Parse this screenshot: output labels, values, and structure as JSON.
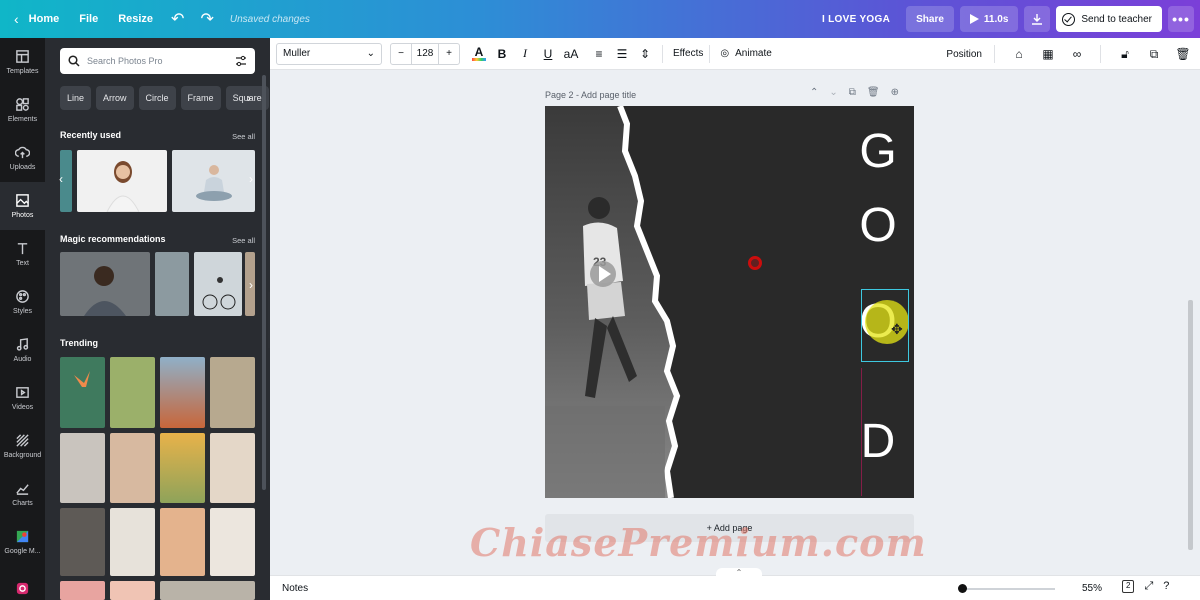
{
  "topbar": {
    "home_label": "Home",
    "file_label": "File",
    "resize_label": "Resize",
    "unsaved_text": "Unsaved changes",
    "design_title": "I LOVE YOGA",
    "share_label": "Share",
    "play_label": "11.0s",
    "teacher_label": "Send to teacher",
    "more_label": "•••"
  },
  "rail": {
    "items": [
      {
        "label": "Templates",
        "icon": "templates-icon"
      },
      {
        "label": "Elements",
        "icon": "elements-icon"
      },
      {
        "label": "Uploads",
        "icon": "uploads-icon"
      },
      {
        "label": "Photos",
        "icon": "photos-icon"
      },
      {
        "label": "Text",
        "icon": "text-icon"
      },
      {
        "label": "Styles",
        "icon": "styles-icon"
      },
      {
        "label": "Audio",
        "icon": "audio-icon"
      },
      {
        "label": "Videos",
        "icon": "videos-icon"
      },
      {
        "label": "Background",
        "icon": "background-icon"
      },
      {
        "label": "Charts",
        "icon": "charts-icon"
      },
      {
        "label": "Google M...",
        "icon": "google-maps-icon"
      },
      {
        "label": "",
        "icon": "instagram-icon"
      }
    ]
  },
  "panel": {
    "search_placeholder": "Search Photos Pro",
    "chips": [
      "Line",
      "Arrow",
      "Circle",
      "Frame",
      "Square"
    ],
    "recently_used": "Recently used",
    "magic": "Magic recommendations",
    "trending": "Trending",
    "see_all": "See all"
  },
  "toolbar": {
    "font": "Muller",
    "font_size": "128",
    "minus": "−",
    "plus": "+",
    "effects": "Effects",
    "animate": "Animate",
    "position": "Position"
  },
  "canvas": {
    "page_label": "Page 2 - Add page title",
    "letters": [
      "G",
      "O",
      "O",
      "D"
    ],
    "add_page": "+ Add page"
  },
  "bottombar": {
    "notes": "Notes",
    "zoom": "55%",
    "page_count": "2"
  },
  "watermark": "ChiasePremium.com",
  "colors": {
    "accent": "#3ec8e0",
    "panel_bg": "#292c31",
    "rail_bg": "#18191b",
    "page_bg": "#292929"
  }
}
